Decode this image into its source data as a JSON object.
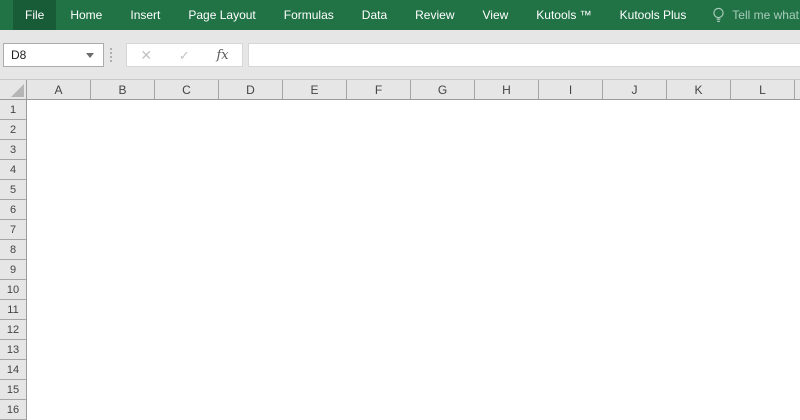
{
  "ribbon": {
    "tabs": [
      {
        "label": "File",
        "active": true
      },
      {
        "label": "Home"
      },
      {
        "label": "Insert"
      },
      {
        "label": "Page Layout"
      },
      {
        "label": "Formulas"
      },
      {
        "label": "Data"
      },
      {
        "label": "Review"
      },
      {
        "label": "View"
      },
      {
        "label": "Kutools ™"
      },
      {
        "label": "Kutools Plus"
      }
    ],
    "tell_me_label": "Tell me what",
    "tell_me_icon": "lightbulb-icon"
  },
  "formula_bar": {
    "name_box_value": "D8",
    "cancel_glyph": "✕",
    "enter_glyph": "✓",
    "fx_glyph": "fx",
    "formula_value": ""
  },
  "sheet": {
    "columns": [
      "A",
      "B",
      "C",
      "D",
      "E",
      "F",
      "G",
      "H",
      "I",
      "J",
      "K",
      "L"
    ],
    "rows": [
      "1",
      "2",
      "3",
      "4",
      "5",
      "6",
      "7",
      "8",
      "9",
      "10",
      "11",
      "12",
      "13",
      "14",
      "15",
      "16"
    ],
    "active_cell": "D8"
  },
  "colors": {
    "ribbon_green": "#217346",
    "file_tab_green": "#185c37",
    "tell_me_text": "#a9cbba",
    "header_bg": "#e6e6e6",
    "header_border": "#9b9b9b",
    "header_text": "#444444"
  }
}
